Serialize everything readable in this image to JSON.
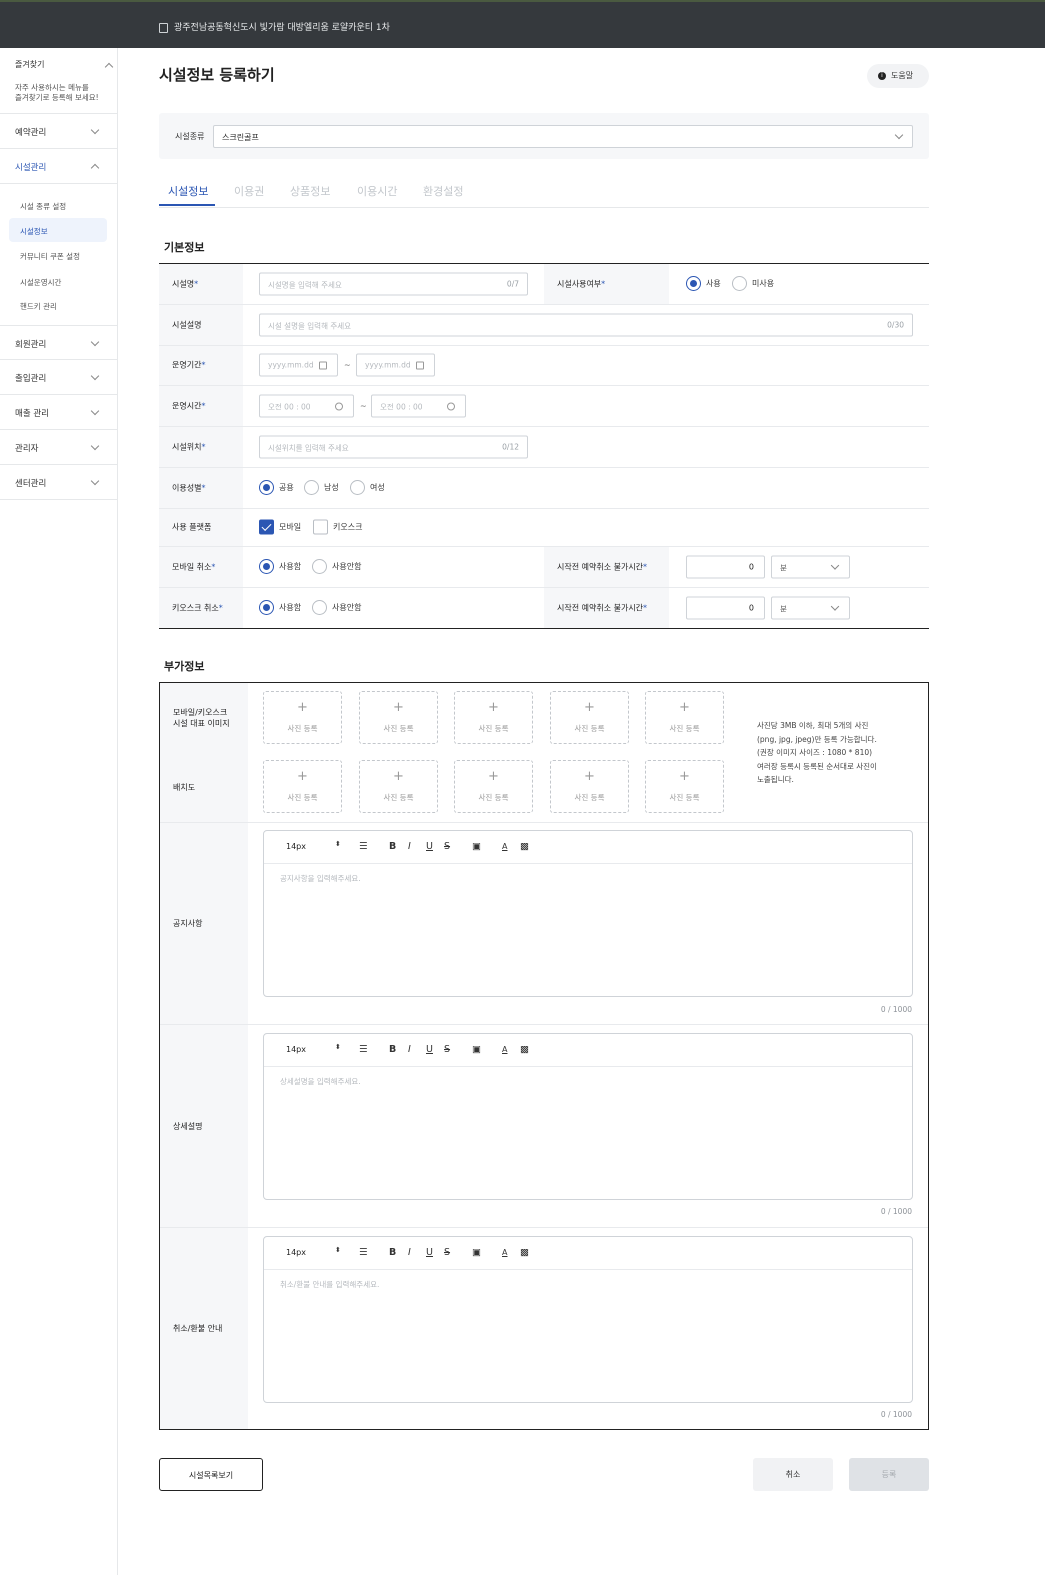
{
  "topbar": {
    "title": "광주전남공동혁신도시 빛가람 대방엘리움 로얄카운티 1차",
    "icon": "document-icon"
  },
  "sidebar": {
    "favorites": {
      "title": "즐겨찾기",
      "desc": "자주 사용하시는 메뉴를\n즐겨찾기로 등록해 보세요!"
    },
    "menus": [
      {
        "label": "예약관리",
        "expanded": false
      },
      {
        "label": "시설관리",
        "expanded": true
      },
      {
        "label": "회원관리",
        "expanded": false
      },
      {
        "label": "출입관리",
        "expanded": false
      },
      {
        "label": "매출 관리",
        "expanded": false
      },
      {
        "label": "관리자",
        "expanded": false
      },
      {
        "label": "센터관리",
        "expanded": false
      }
    ],
    "submenu": [
      "시설 종류 설정",
      "시설정보",
      "커뮤니티 쿠폰 설정",
      "시설운영시간",
      "핸드키 관리"
    ],
    "active_submenu": "시설정보"
  },
  "page": {
    "title": "시설정보 등록하기",
    "help": "도움말",
    "accent": "#2b56b3"
  },
  "facility_type": {
    "label": "시설종류",
    "value": "스크린골프"
  },
  "tabs": [
    "시설정보",
    "이용권",
    "상품정보",
    "이용시간",
    "환경설정"
  ],
  "basic": {
    "section": "기본정보",
    "name": {
      "label": "시설명",
      "placeholder": "시설명을 입력해 주세요",
      "count": "0/7"
    },
    "use_status": {
      "label": "시설사용여부",
      "options": [
        "사용",
        "미사용"
      ],
      "selected": "사용"
    },
    "desc": {
      "label": "시설설명",
      "placeholder": "시설 설명을 입력해 주세요",
      "count": "0/30"
    },
    "period": {
      "label": "운영기간",
      "start": "yyyy.mm.dd",
      "end": "yyyy.mm.dd",
      "sep": "~"
    },
    "hours": {
      "label": "운영시간",
      "start": "오전 00 : 00",
      "end": "오전 00 : 00",
      "sep": "~"
    },
    "location": {
      "label": "시설위치",
      "placeholder": "시설위치를 입력해 주세요",
      "count": "0/12"
    },
    "gender": {
      "label": "이용성별",
      "options": [
        "공용",
        "남성",
        "여성"
      ],
      "selected": "공용"
    },
    "platform": {
      "label": "사용 플랫폼",
      "options": [
        "모바일",
        "키오스크"
      ],
      "checked": [
        "모바일"
      ]
    },
    "mobile_cancel": {
      "label": "모바일 취소",
      "options": [
        "사용함",
        "사용안함"
      ],
      "selected": "사용함",
      "limit_label": "시작전 예약취소 불가시간",
      "value": "0",
      "unit": "분"
    },
    "kiosk_cancel": {
      "label": "키오스크 취소",
      "options": [
        "사용함",
        "사용안함"
      ],
      "selected": "사용함",
      "limit_label": "시작전 예약취소 불가시간",
      "value": "0",
      "unit": "분"
    },
    "required_mark": "*"
  },
  "extra": {
    "section": "부가정보",
    "image_label": "모바일/키오스크\n시설 대표 이미지",
    "layout_label": "배치도",
    "photo_button": "사진 등록",
    "photo_plus": "+",
    "note": "사진당 3MB 이하, 최대 5개의 사진\n(png, jpg, jpeg)만 등록 가능합니다.\n(권장 이미지 사이즈 : 1080 * 810)\n여러장 등록시 등록된 순서대로 사진이\n노출됩니다.",
    "editors": [
      {
        "label": "공지사항",
        "placeholder": "공지사항을 입력해주세요.",
        "count": "0 / 1000",
        "font_size": "14px"
      },
      {
        "label": "상세설명",
        "placeholder": "상세설명을 입력해주세요.",
        "count": "0 / 1000",
        "font_size": "14px"
      },
      {
        "label": "취소/환불 안내",
        "placeholder": "취소/환불 안내를 입력해주세요.",
        "count": "0 / 1000",
        "font_size": "14px"
      }
    ],
    "toolbar_glyphs": {
      "align": "☰",
      "bold": "B",
      "italic": "I",
      "underline": "U",
      "strike": "S",
      "image": "▣",
      "color": "A",
      "bg": "▩",
      "stepper": "⬍"
    }
  },
  "footer": {
    "list_button": "시설목록보기",
    "cancel_button": "취소",
    "submit_button": "등록"
  }
}
